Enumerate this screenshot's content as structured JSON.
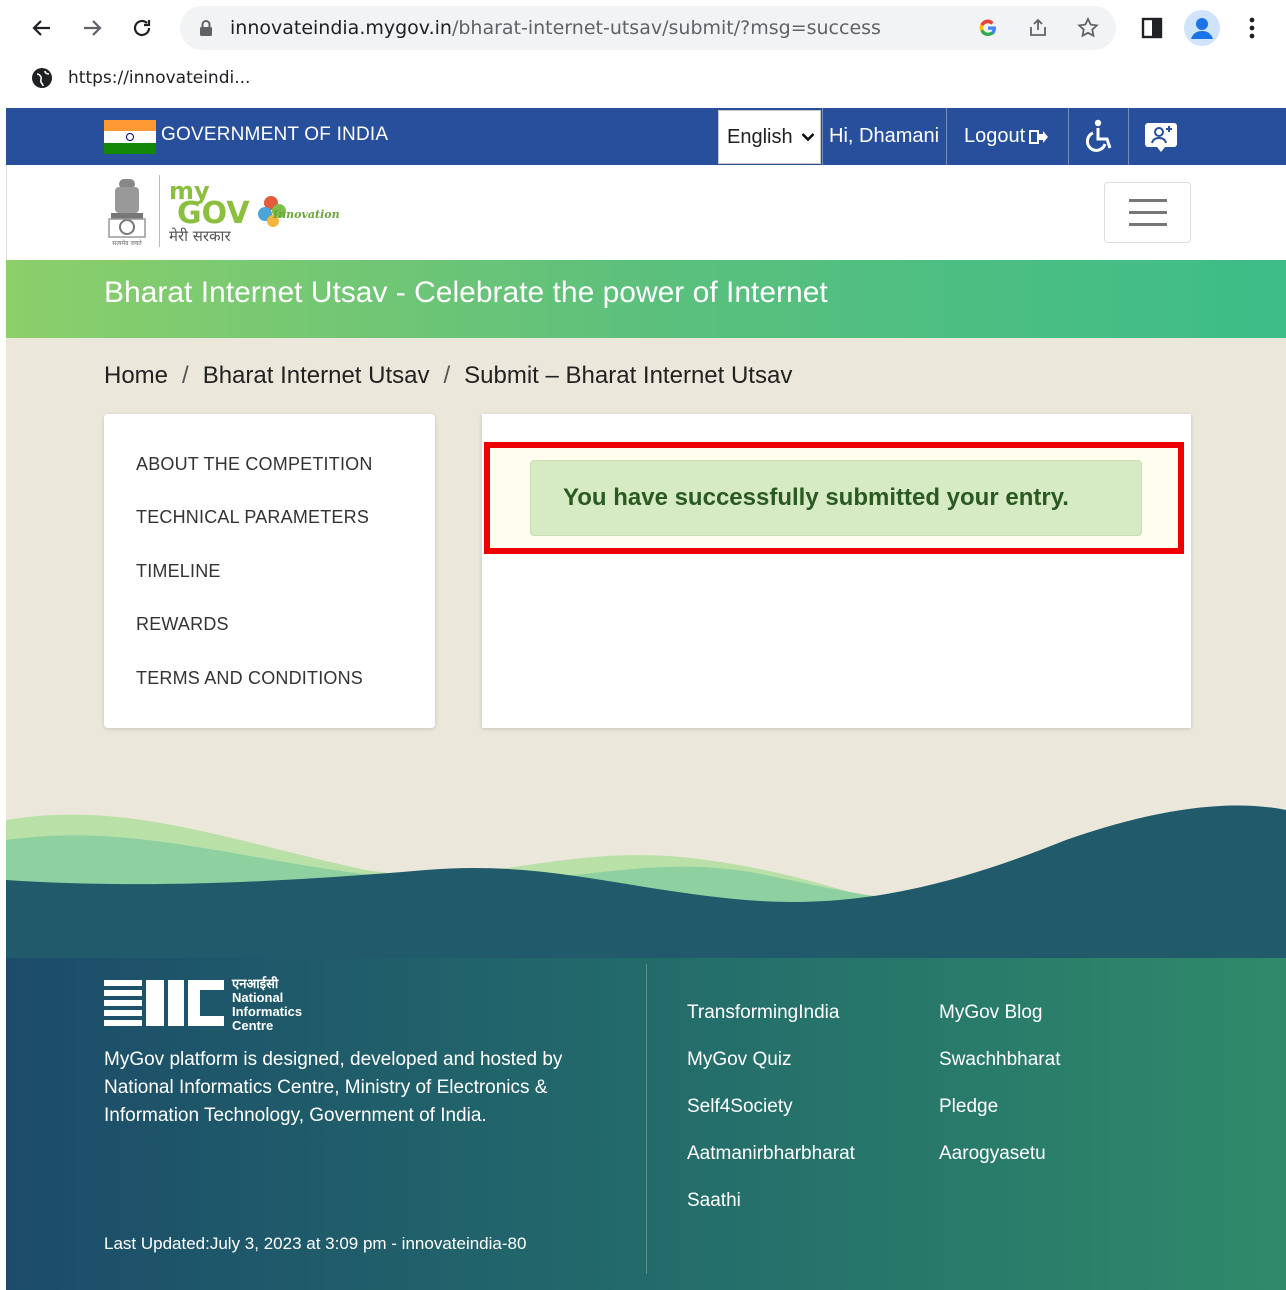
{
  "browser": {
    "url_host": "innovateindia.mygov.in",
    "url_path": "/bharat-internet-utsav/submit/?msg=success",
    "tab_url": "https://innovateindi..."
  },
  "govbar": {
    "title": "GOVERNMENT OF INDIA",
    "language": "English",
    "greeting": "Hi, Dhamani",
    "logout": "Logout"
  },
  "banner": {
    "title": "Bharat Internet Utsav - Celebrate the power of Internet"
  },
  "breadcrumb": {
    "home": "Home",
    "section": "Bharat Internet Utsav",
    "current": "Submit – Bharat Internet Utsav"
  },
  "sidebar": {
    "items": [
      {
        "label": "ABOUT THE COMPETITION"
      },
      {
        "label": "TECHNICAL PARAMETERS"
      },
      {
        "label": "TIMELINE"
      },
      {
        "label": "REWARDS"
      },
      {
        "label": "TERMS AND CONDITIONS"
      }
    ]
  },
  "main": {
    "success_message": "You have successfully submitted your entry."
  },
  "footer": {
    "nic_hindi": "एनआईसी",
    "nic_line1": "National",
    "nic_line2": "Informatics",
    "nic_line3": "Centre",
    "description": "MyGov platform is designed, developed and hosted by National Informatics Centre, Ministry of Electronics & Information Technology, Government of India.",
    "last_updated": "Last Updated:July 3, 2023 at 3:09 pm - innovateindia-80",
    "links_col1": [
      "TransformingIndia",
      "MyGov Quiz",
      "Self4Society",
      "Aatmanirbharbharat",
      "Saathi"
    ],
    "links_col2": [
      "MyGov Blog",
      "Swachhbharat",
      "Pledge",
      "Aarogyasetu"
    ]
  },
  "logo": {
    "my": "my",
    "gov": "GOV",
    "hindi": "मेरी सरकार",
    "innovation": "Innovation",
    "emblem_caption": "सत्यमेव जयते"
  },
  "colors": {
    "govbar": "#274f9c",
    "banner_start": "#8ccf6b",
    "banner_end": "#3dbd88",
    "highlight_border": "#ee0000",
    "success_bg": "#d6eac4",
    "success_text": "#2a5a22"
  }
}
